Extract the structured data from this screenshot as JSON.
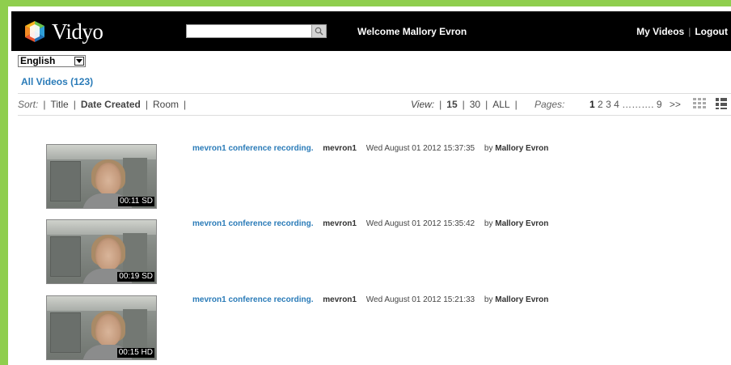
{
  "header": {
    "brand": "Vidyo",
    "welcome": "Welcome Mallory Evron",
    "my_videos": "My Videos",
    "separator": "|",
    "logout": "Logout",
    "search": {
      "value": "",
      "placeholder": ""
    }
  },
  "language": {
    "selected": "English"
  },
  "all_videos": "All Videos (123)",
  "toolbar": {
    "sort_label": "Sort:",
    "sort_options": [
      "Title",
      "Date Created",
      "Room"
    ],
    "view_label": "View:",
    "view_options": [
      "15",
      "30",
      "ALL"
    ],
    "pages_label": "Pages:",
    "pages": [
      "1",
      "2",
      "3",
      "4"
    ],
    "pages_gap": "……….",
    "last_page": "9",
    "next": ">>"
  },
  "videos": [
    {
      "title": "mevron1 conference recording.",
      "owner": "mevron1",
      "date": "Wed August 01 2012 15:37:35",
      "by_prefix": "by",
      "by_name": "Mallory Evron",
      "duration": "00:11 SD"
    },
    {
      "title": "mevron1 conference recording.",
      "owner": "mevron1",
      "date": "Wed August 01 2012 15:35:42",
      "by_prefix": "by",
      "by_name": "Mallory Evron",
      "duration": "00:19 SD"
    },
    {
      "title": "mevron1 conference recording.",
      "owner": "mevron1",
      "date": "Wed August 01 2012 15:21:33",
      "by_prefix": "by",
      "by_name": "Mallory Evron",
      "duration": "00:15 HD"
    }
  ],
  "colors": {
    "frame": "#8fce4e",
    "header_bg": "#000000",
    "link": "#2a7bb8"
  }
}
